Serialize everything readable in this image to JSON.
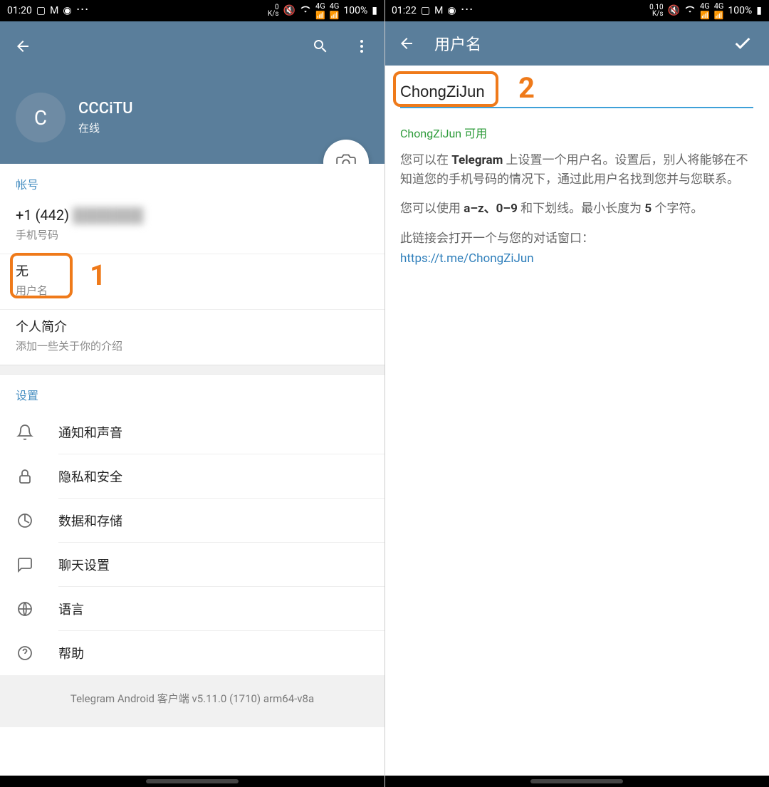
{
  "left": {
    "status": {
      "time": "01:20",
      "net": "0",
      "net_unit": "K/s",
      "battery": "100%"
    },
    "profile": {
      "initial": "C",
      "name": "CCCiTU",
      "status": "在线"
    },
    "account": {
      "header": "帐号",
      "phone_value": "+1 (442)",
      "phone_hidden": "███████",
      "phone_label": "手机号码",
      "username_value": "无",
      "username_label": "用户名",
      "bio_title": "个人简介",
      "bio_desc": "添加一些关于你的介绍"
    },
    "settings": {
      "header": "设置",
      "items": [
        {
          "label": "通知和声音"
        },
        {
          "label": "隐私和安全"
        },
        {
          "label": "数据和存储"
        },
        {
          "label": "聊天设置"
        },
        {
          "label": "语言"
        },
        {
          "label": "帮助"
        }
      ]
    },
    "footer": "Telegram Android 客户端 v5.11.0 (1710) arm64-v8a",
    "annot": "1"
  },
  "right": {
    "status": {
      "time": "01:22",
      "net": "0.10",
      "net_unit": "K/s",
      "battery": "100%"
    },
    "title": "用户名",
    "input_value": "ChongZiJun",
    "available": "ChongZiJun 可用",
    "desc1a": "您可以在 ",
    "desc1b": "Telegram",
    "desc1c": " 上设置一个用户名。设置后，别人将能够在不知道您的手机号码的情况下，通过此用户名找到您并与您联系。",
    "desc2a": "您可以使用 ",
    "desc2b": "a–z、0–9",
    "desc2c": " 和下划线。最小长度为 ",
    "desc2d": "5",
    "desc2e": " 个字符。",
    "desc3": "此链接会打开一个与您的对话窗口：",
    "link": "https://t.me/ChongZiJun",
    "annot": "2"
  }
}
